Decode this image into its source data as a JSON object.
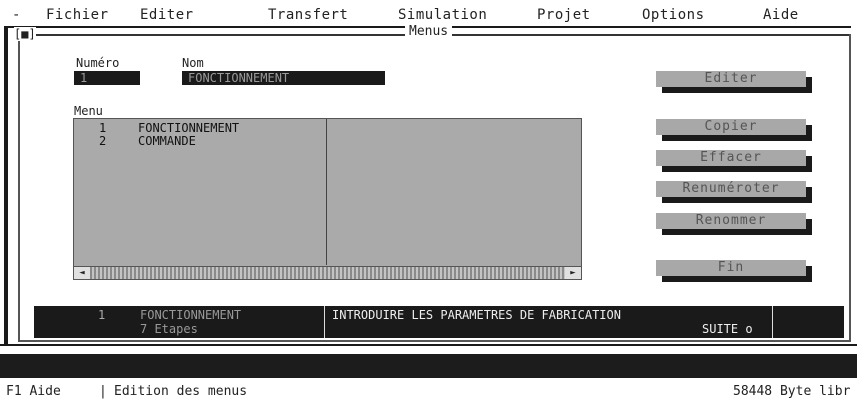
{
  "menubar": {
    "system": "-",
    "items": [
      "Fichier",
      "Editer",
      "Transfert",
      "Simulation",
      "Projet",
      "Options",
      "Aide"
    ]
  },
  "window": {
    "sysbox": "[■]",
    "title": "Menus"
  },
  "form": {
    "numero_label": "Numéro",
    "numero_value": "1",
    "nom_label": "Nom",
    "nom_value": "FONCTIONNEMENT",
    "menu_label": "Menu"
  },
  "menu_list": [
    {
      "num": "1",
      "name": "FONCTIONNEMENT"
    },
    {
      "num": "2",
      "name": "COMMANDE"
    }
  ],
  "scrollbar": {
    "left_arrow": "◄",
    "right_arrow": "►"
  },
  "buttons": {
    "editer": "Editer",
    "copier": "Copier",
    "effacer": "Effacer",
    "renumeroter": "Renuméroter",
    "renommer": "Renommer",
    "fin": "Fin"
  },
  "status": {
    "num": "1",
    "name": "FONCTIONNEMENT",
    "steps": "7 Etapes",
    "description": "INTRODUIRE LES PARAMETRES DE FABRICATION",
    "suite": "SUITE o"
  },
  "fkeybar": {
    "key": "F1 Aide",
    "separator": "|",
    "context": "Edition des menus",
    "memory": "58448 Byte libr"
  }
}
